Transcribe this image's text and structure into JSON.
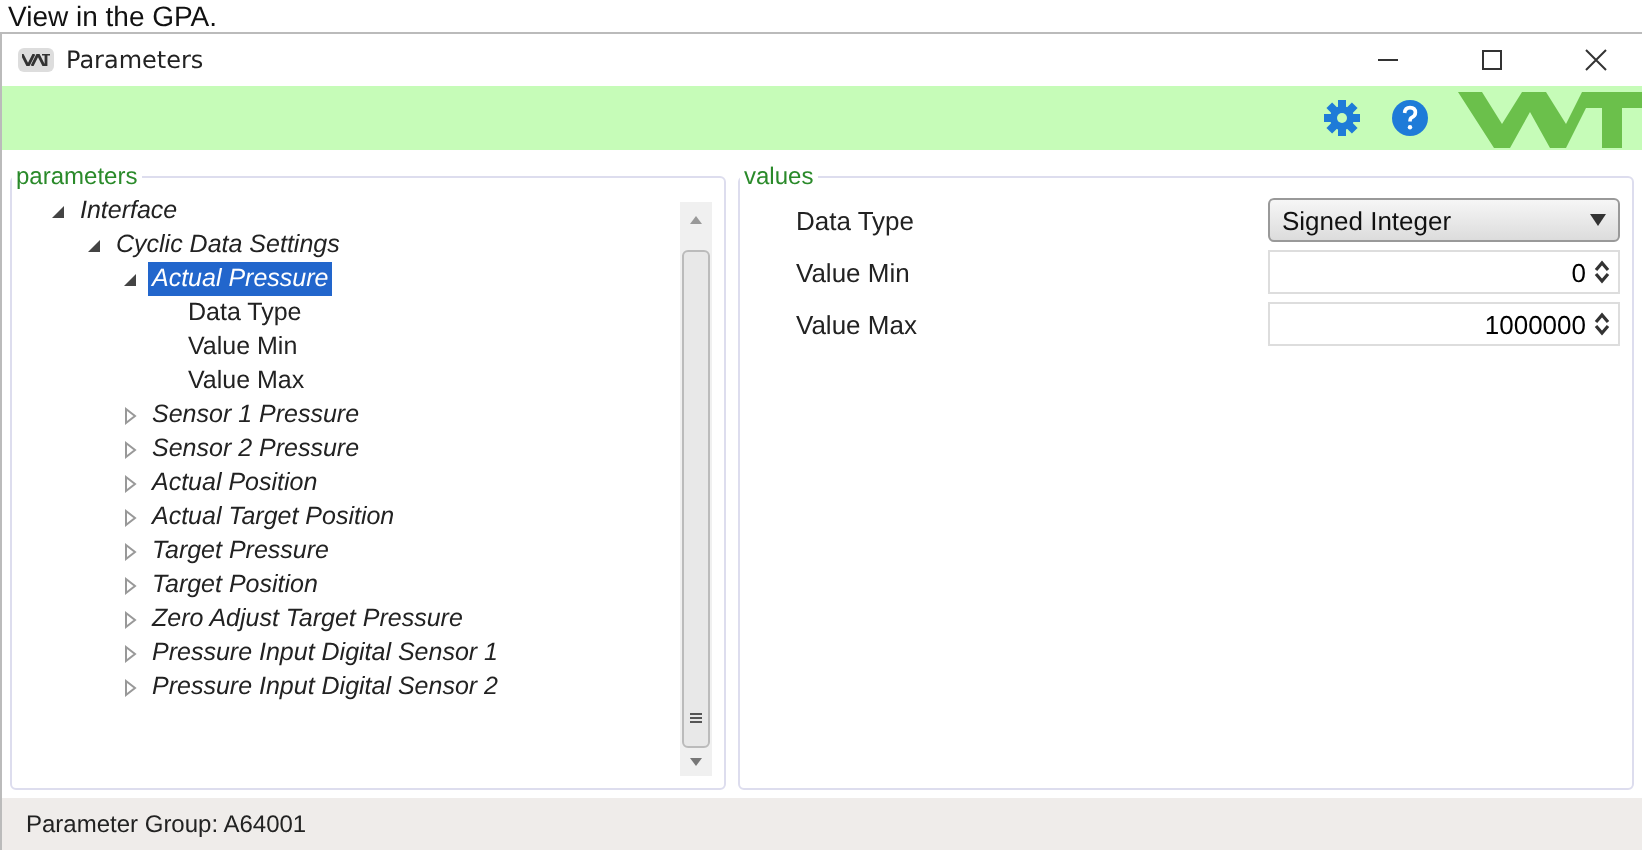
{
  "caption": "View in the GPA.",
  "window": {
    "title": "Parameters"
  },
  "parameters": {
    "title": "parameters",
    "tree": [
      {
        "label": "Interface",
        "expanded": true,
        "selected": false,
        "children": [
          {
            "label": "Cyclic Data Settings",
            "expanded": true,
            "selected": false,
            "children": [
              {
                "label": "Actual Pressure",
                "expanded": true,
                "selected": true,
                "children": [
                  {
                    "label": "Data Type",
                    "selected": false
                  },
                  {
                    "label": "Value Min",
                    "selected": false
                  },
                  {
                    "label": "Value Max",
                    "selected": false
                  }
                ]
              },
              {
                "label": "Sensor 1 Pressure",
                "expanded": false,
                "selected": false
              },
              {
                "label": "Sensor 2 Pressure",
                "expanded": false,
                "selected": false
              },
              {
                "label": "Actual Position",
                "expanded": false,
                "selected": false
              },
              {
                "label": "Actual Target Position",
                "expanded": false,
                "selected": false
              },
              {
                "label": "Target Pressure",
                "expanded": false,
                "selected": false
              },
              {
                "label": "Target Position",
                "expanded": false,
                "selected": false
              },
              {
                "label": "Zero Adjust Target Pressure",
                "expanded": false,
                "selected": false
              },
              {
                "label": "Pressure Input Digital Sensor 1",
                "expanded": false,
                "selected": false
              },
              {
                "label": "Pressure Input Digital Sensor 2",
                "expanded": false,
                "selected": false
              }
            ]
          }
        ]
      }
    ]
  },
  "values": {
    "title": "values",
    "rows": [
      {
        "label": "Data Type",
        "kind": "dropdown",
        "value": "Signed Integer"
      },
      {
        "label": "Value Min",
        "kind": "spinner",
        "value": "0"
      },
      {
        "label": "Value Max",
        "kind": "spinner",
        "value": "1000000"
      }
    ]
  },
  "status_bar": "Parameter Group: A64001"
}
